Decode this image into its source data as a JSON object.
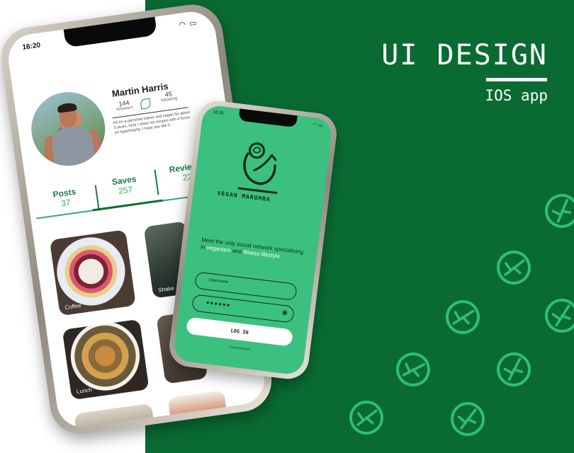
{
  "hero": {
    "title": "UI DESIGN",
    "subtitle": "IOS app"
  },
  "colors": {
    "brand_green": "#0a6b32",
    "app_green": "#3cc07f",
    "leaf_pattern": "#2fbf72"
  },
  "profile_screen": {
    "status_time": "16:20",
    "user_name": "Martin Harris",
    "followers_count": "144",
    "followers_label": "followers",
    "following_count": "45",
    "following_label": "following",
    "bio": "Hi! Im a personal trainer and vegan for about 3 years, here I show my recipes with a focus on hypertrophy, I hope you like it",
    "tabs": [
      {
        "label": "Posts",
        "count": "37"
      },
      {
        "label": "Saves",
        "count": "257"
      },
      {
        "label": "Reviews",
        "count": "22"
      }
    ],
    "posts": [
      {
        "label": "Coffee"
      },
      {
        "label": "Shake"
      },
      {
        "label": "Lunch"
      }
    ]
  },
  "login_screen": {
    "status_time": "16:20",
    "brand_name": "VEGAN  MAROMBA",
    "tagline_prefix": "Meet the only social network specializing in ",
    "tagline_hl1": "veganism",
    "tagline_mid": " and ",
    "tagline_hl2": "fitness lifestyle.",
    "username_placeholder": "Username",
    "password_mask": "●●●●●●",
    "login_label": "LOG IN",
    "forgot_label": "Forgot password"
  }
}
